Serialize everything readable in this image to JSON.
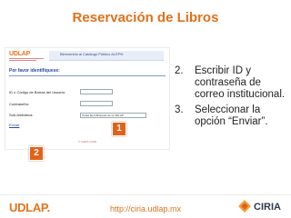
{
  "slide": {
    "title": "Reservación de Libros"
  },
  "screenshot": {
    "logo_text": "UDLAP",
    "banner_text": "Bienvenido al Catálogo Público ALEPH",
    "identify_heading": "Por favor identifíquese:",
    "fields": {
      "id_label": "ID o Código de Barras del Usuario:",
      "password_label": "Contraseña:",
      "library_label": "Sub-biblioteca:",
      "library_selected": "Todas las bibliotecas de la UDLAP"
    },
    "send_link": "Enviar",
    "footnote": "© ALEPH 2006"
  },
  "markers": {
    "one": "1",
    "two": "2"
  },
  "steps": [
    {
      "number": "2.",
      "text": "Escribir ID y contraseña de correo institucional."
    },
    {
      "number": "3.",
      "text": "Seleccionar la opción “Enviar”."
    }
  ],
  "footer": {
    "left_logo": "UDLAP.",
    "url": "http://ciria.udlap.mx",
    "right_logo": "CIRIA"
  },
  "colors": {
    "accent": "#e0701a",
    "marker": "#e2621b",
    "link": "#2a4aa0"
  }
}
